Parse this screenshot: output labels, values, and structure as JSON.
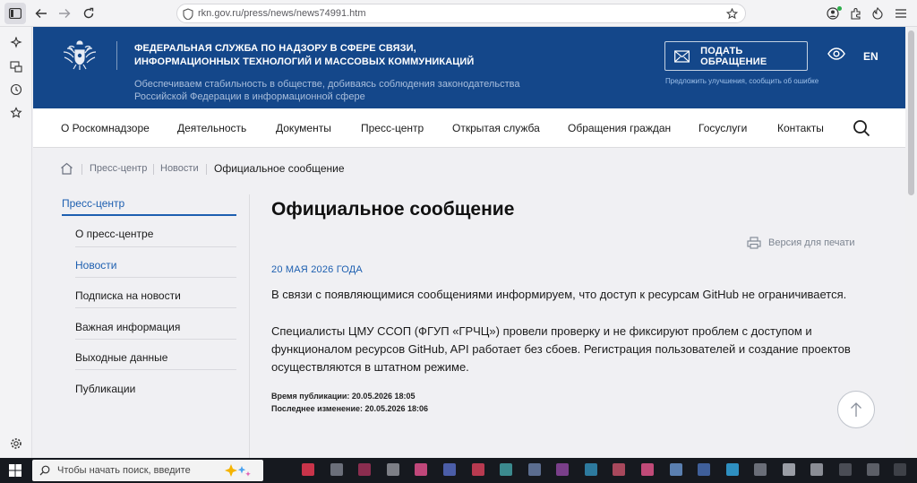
{
  "browser": {
    "url": "rkn.gov.ru/press/news/news74991.htm"
  },
  "site": {
    "org_line1": "ФЕДЕРАЛЬНАЯ СЛУЖБА ПО НАДЗОРУ В СФЕРЕ СВЯЗИ,",
    "org_line2": "ИНФОРМАЦИОННЫХ ТЕХНОЛОГИЙ И МАССОВЫХ КОММУНИКАЦИЙ",
    "tagline_line1": "Обеспечиваем стабильность в обществе, добиваясь соблюдения законодательства",
    "tagline_line2": "Российской Федерации в информационной сфере",
    "appeal_button": "ПОДАТЬ ОБРАЩЕНИЕ",
    "suggest_link": "Предложить улучшения, сообщить об ошибке",
    "lang": "EN",
    "brand_color": "#14478a"
  },
  "nav": {
    "items": [
      "О Роскомнадзоре",
      "Деятельность",
      "Документы",
      "Пресс-центр",
      "Открытая служба",
      "Обращения граждан",
      "Госуслуги",
      "Контакты"
    ]
  },
  "breadcrumb": {
    "items": [
      "Пресс-центр",
      "Новости"
    ],
    "current": "Официальное сообщение"
  },
  "submenu": {
    "title": "Пресс-центр",
    "items": [
      "О пресс-центре",
      "Новости",
      "Подписка на новости",
      "Важная информация",
      "Выходные данные",
      "Публикации"
    ],
    "active": "Новости"
  },
  "article": {
    "title": "Официальное сообщение",
    "print_label": "Версия для печати",
    "date": "20 МАЯ 2026 ГОДА",
    "para1": "В связи с появляющимися сообщениями информируем, что доступ к ресурсам GitHub не ограничивается.",
    "para2_line1": "Специалисты ЦМУ ССОП (ФГУП «ГРЧЦ») провели проверку и не фиксируют проблем с доступом и",
    "para2_line2": "функционалом ресурсов GitHub, API работает без сбоев. Регистрация пользователей и создание проектов",
    "para2_line3": "осуществляются в штатном режиме.",
    "published": "Время публикации: 20.05.2026 18:05",
    "modified": "Последнее изменение: 20.05.2026 18:06"
  },
  "taskbar": {
    "search_placeholder": "Чтобы начать поиск, введите"
  }
}
